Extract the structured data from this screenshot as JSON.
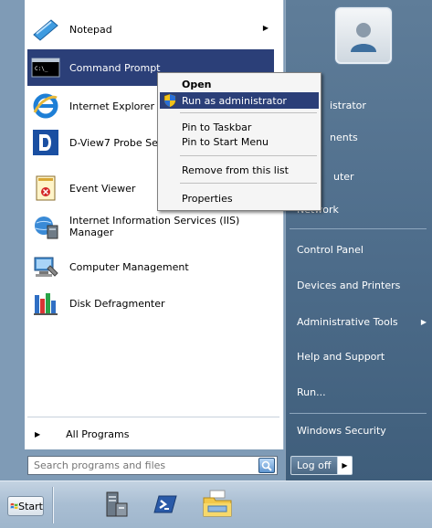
{
  "programs": [
    {
      "label": "Notepad",
      "has_submenu": true
    },
    {
      "label": "Command Prompt",
      "highlighted": true
    },
    {
      "label": "Internet Explorer"
    },
    {
      "label": "D-View7 Probe Se"
    },
    {
      "label": "Event Viewer"
    },
    {
      "label": "Internet Information Services (IIS) Manager"
    },
    {
      "label": "Computer Management"
    },
    {
      "label": "Disk Defragmenter"
    }
  ],
  "all_programs": "All Programs",
  "search": {
    "placeholder": "Search programs and files"
  },
  "right_pane": {
    "items": [
      {
        "label": "istrator"
      },
      {
        "label": "nents"
      },
      {
        "label": "uter"
      },
      {
        "label": "Network"
      },
      {
        "label": "Control Panel"
      },
      {
        "label": "Devices and Printers"
      },
      {
        "label": "Administrative Tools",
        "has_submenu": true
      },
      {
        "label": "Help and Support"
      },
      {
        "label": "Run..."
      },
      {
        "label": "Windows Security"
      }
    ],
    "log_off": "Log off"
  },
  "context_menu": {
    "items": [
      {
        "label": "Open",
        "bold": true
      },
      {
        "label": "Run as administrator",
        "highlighted": true,
        "icon": "uac-shield-icon"
      },
      {
        "label": "Pin to Taskbar"
      },
      {
        "label": "Pin to Start Menu"
      },
      {
        "label": "Remove from this list"
      },
      {
        "label": "Properties"
      }
    ]
  },
  "taskbar": {
    "start_label": "Start",
    "pinned": [
      "server-manager-icon",
      "powershell-icon",
      "explorer-folder-icon"
    ]
  },
  "colors": {
    "highlight": "#2b3f78",
    "right_pane": "#4d6c8a",
    "taskbar": "#a9bed3"
  }
}
